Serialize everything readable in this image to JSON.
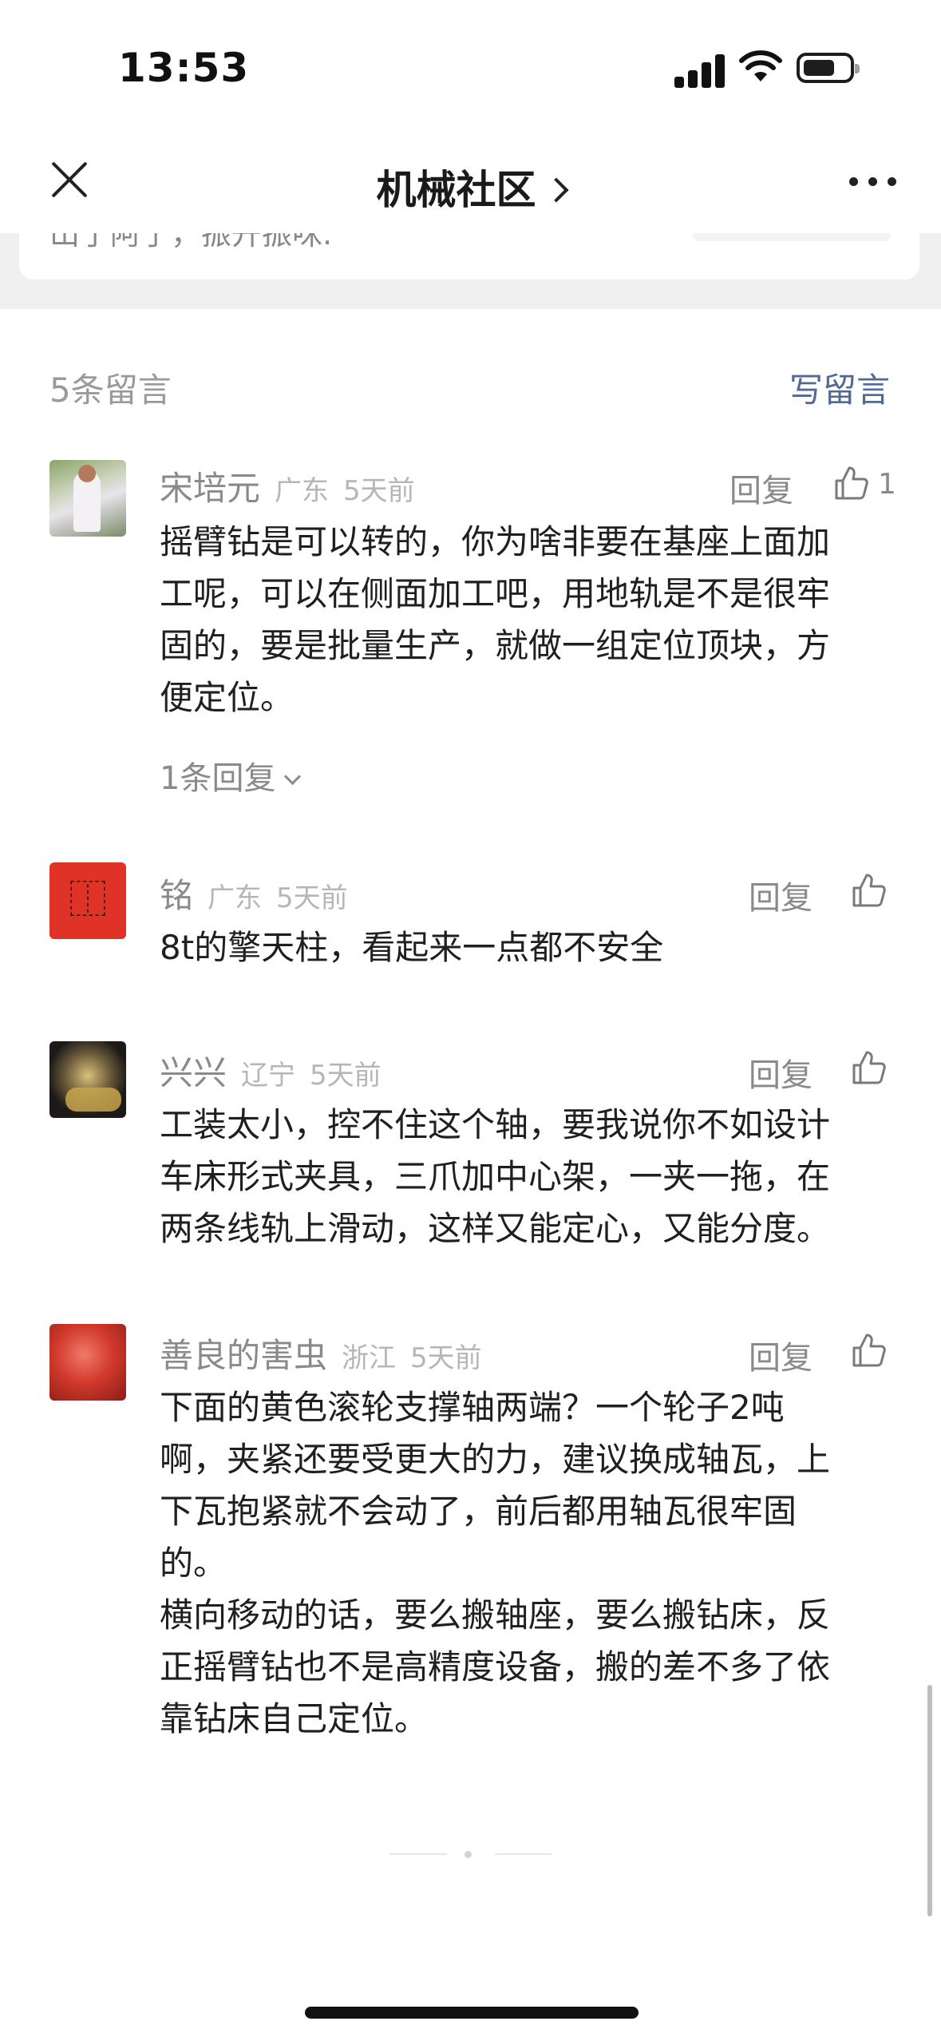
{
  "status_bar": {
    "time": "13:53"
  },
  "nav": {
    "title": "机械社区"
  },
  "prev_card": {
    "partial_text": "山了阿了，振开振咪."
  },
  "comments_header": {
    "count_label": "5条留言",
    "write_label": "写留言"
  },
  "comments": [
    {
      "name": "宋培元",
      "region": "广东",
      "time": "5天前",
      "reply_label": "回复",
      "likes": "1",
      "text": "摇臂钻是可以转的，你为啥非要在基座上面加\n工呢，可以在侧面加工吧，用地轨是不是很牢\n固的，要是批量生产，就做一组定位顶块，方\n便定位。",
      "replies_label": "1条回复"
    },
    {
      "name": "铭",
      "region": "广东",
      "time": "5天前",
      "reply_label": "回复",
      "text": "8t的擎天柱，看起来一点都不安全"
    },
    {
      "name": "兴兴",
      "region": "辽宁",
      "time": "5天前",
      "reply_label": "回复",
      "text": "工装太小，控不住这个轴，要我说你不如设计\n车床形式夹具，三爪加中心架，一夹一拖，在\n两条线轨上滑动，这样又能定心，又能分度。"
    },
    {
      "name": "善良的害虫",
      "region": "浙江",
      "time": "5天前",
      "reply_label": "回复",
      "text": "下面的黄色滚轮支撑轴两端？一个轮子2吨\n啊，夹紧还要受更大的力，建议换成轴瓦，上\n下瓦抱紧就不会动了，前后都用轴瓦很牢固\n的。\n横向移动的话，要么搬轴座，要么搬钻床，反\n正摇臂钻也不是高精度设备，搬的差不多了依\n靠钻床自己定位。"
    }
  ],
  "icons": {
    "close": "close-icon",
    "more": "more-icon",
    "like": "thumbs-up-icon",
    "expand": "chevron-down-icon"
  },
  "colors": {
    "link": "#516a93",
    "secondary_text": "#8a8a8a"
  }
}
